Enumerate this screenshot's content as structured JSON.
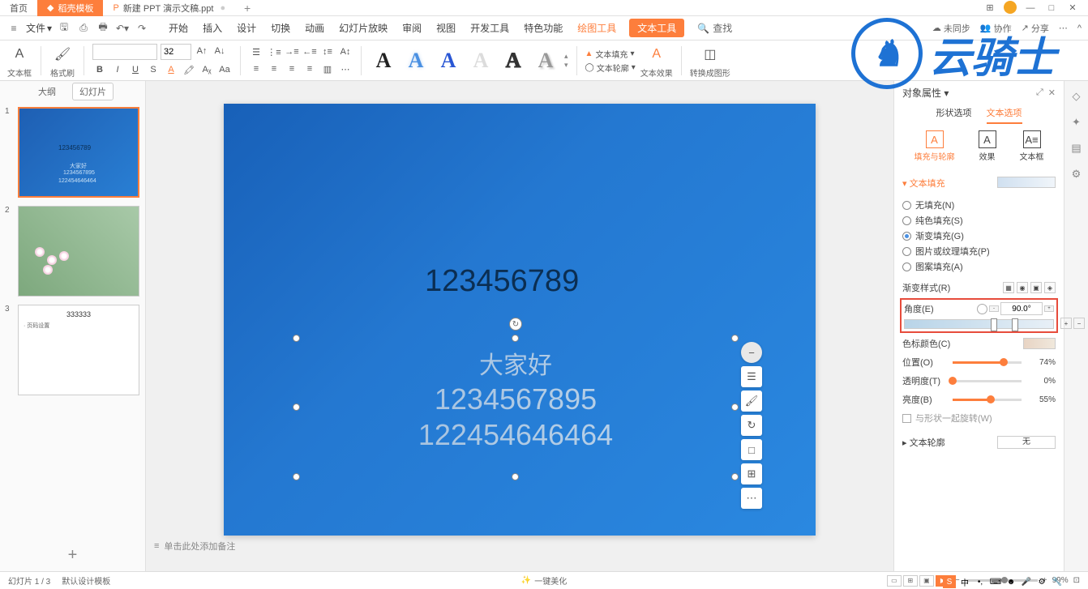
{
  "titlebar": {
    "home": "首页",
    "tab1": "稻壳模板",
    "tab2": "新建 PPT 演示文稿.ppt",
    "add": "+"
  },
  "menubar": {
    "file": "文件",
    "tabs": {
      "start": "开始",
      "insert": "插入",
      "design": "设计",
      "transition": "切换",
      "animation": "动画",
      "slideshow": "幻灯片放映",
      "review": "审阅",
      "view": "视图",
      "developer": "开发工具",
      "special": "特色功能",
      "drawing": "绘图工具",
      "text": "文本工具"
    },
    "search": "查找",
    "right": {
      "unsync": "未同步",
      "coop": "协作",
      "share": "分享"
    }
  },
  "ribbon": {
    "textbox": "文本框",
    "format": "格式刷",
    "fontsize": "32",
    "textfill": "文本填充",
    "textoutline": "文本轮廓",
    "texteffect": "文本效果",
    "toimage": "转换成图形"
  },
  "leftpanel": {
    "outline": "大纲",
    "slides": "幻灯片",
    "t1": {
      "line1": "123456789",
      "line2": "大家好",
      "line3": "1234567895",
      "line4": "122454646464"
    },
    "t3": {
      "title": "333333",
      "bullet": "· 页码设置"
    }
  },
  "canvas": {
    "bignum": "123456789",
    "l1": "大家好",
    "l2": "1234567895",
    "l3": "122454646464",
    "notes_placeholder": "单击此处添加备注"
  },
  "rp": {
    "title": "对象属性",
    "tab_shape": "形状选项",
    "tab_text": "文本选项",
    "sub_fill": "填充与轮廓",
    "sub_effect": "效果",
    "sub_textbox": "文本框",
    "section_fill": "文本填充",
    "fill_none": "无填充(N)",
    "fill_solid": "纯色填充(S)",
    "fill_grad": "渐变填充(G)",
    "fill_pic": "图片或纹理填充(P)",
    "fill_pattern": "图案填充(A)",
    "grad_style": "渐变样式(R)",
    "angle": "角度(E)",
    "angle_val": "90.0°",
    "stop_color": "色标颜色(C)",
    "position": "位置(O)",
    "position_val": "74%",
    "transparency": "透明度(T)",
    "transparency_val": "0%",
    "brightness": "亮度(B)",
    "brightness_val": "55%",
    "rotate_with": "与形状一起旋转(W)",
    "section_outline": "文本轮廓",
    "outline_none": "无"
  },
  "statusbar": {
    "slide_pos": "幻灯片 1 / 3",
    "template": "默认设计模板",
    "beautify": "一键美化",
    "zoom": "99%"
  },
  "watermark": "云骑士"
}
